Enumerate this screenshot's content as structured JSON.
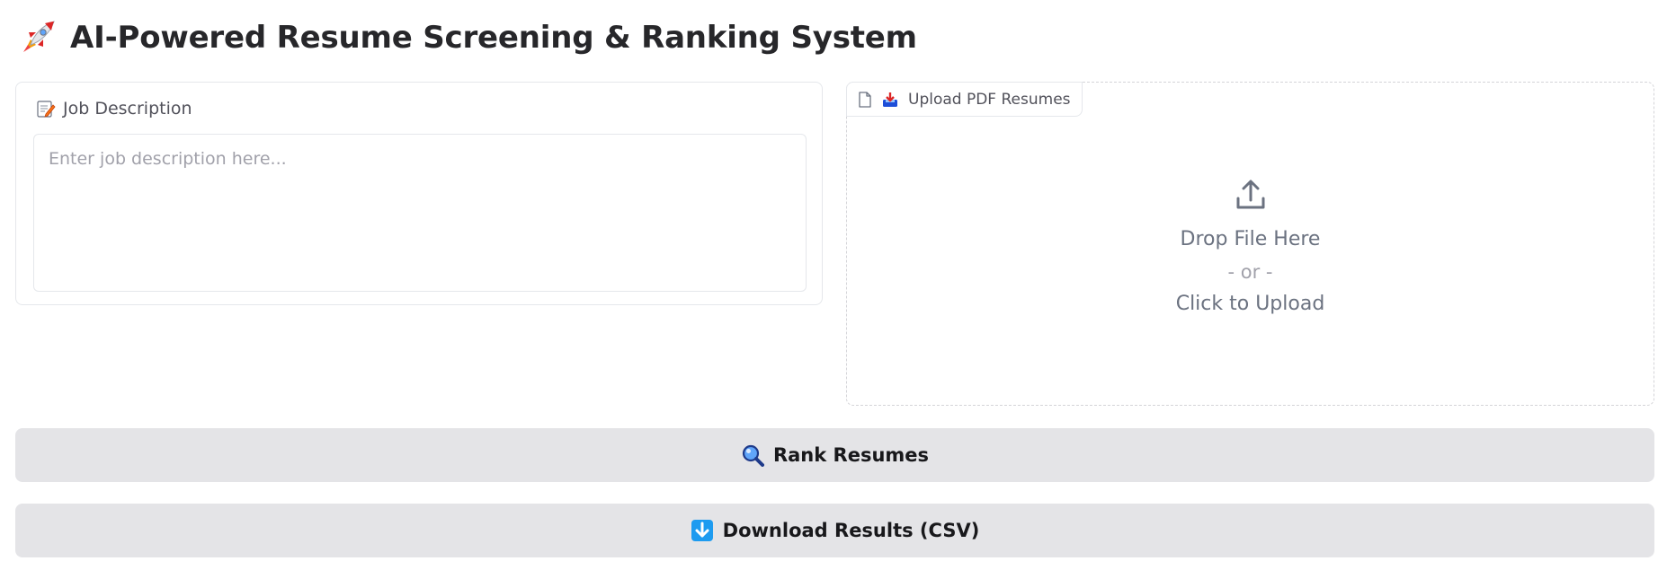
{
  "header": {
    "title": "AI-Powered Resume Screening & Ranking System",
    "icon": "rocket-icon"
  },
  "job_description": {
    "label": "Job Description",
    "icon": "memo-icon",
    "placeholder": "Enter job description here...",
    "value": ""
  },
  "upload": {
    "tab_label": "Upload PDF Resumes",
    "tab_icons": [
      "file-icon",
      "inbox-tray-icon"
    ],
    "drop_text": "Drop File Here",
    "or_text": "- or -",
    "click_text": "Click to Upload",
    "icon": "upload-arrow-icon"
  },
  "actions": {
    "rank_label": "Rank Resumes",
    "rank_icon": "magnifier-icon",
    "download_label": "Download Results (CSV)",
    "download_icon": "down-arrow-icon"
  },
  "colors": {
    "button_bg": "#e4e4e7",
    "border": "#e5e7eb",
    "accent_blue": "#1d9bf0"
  }
}
